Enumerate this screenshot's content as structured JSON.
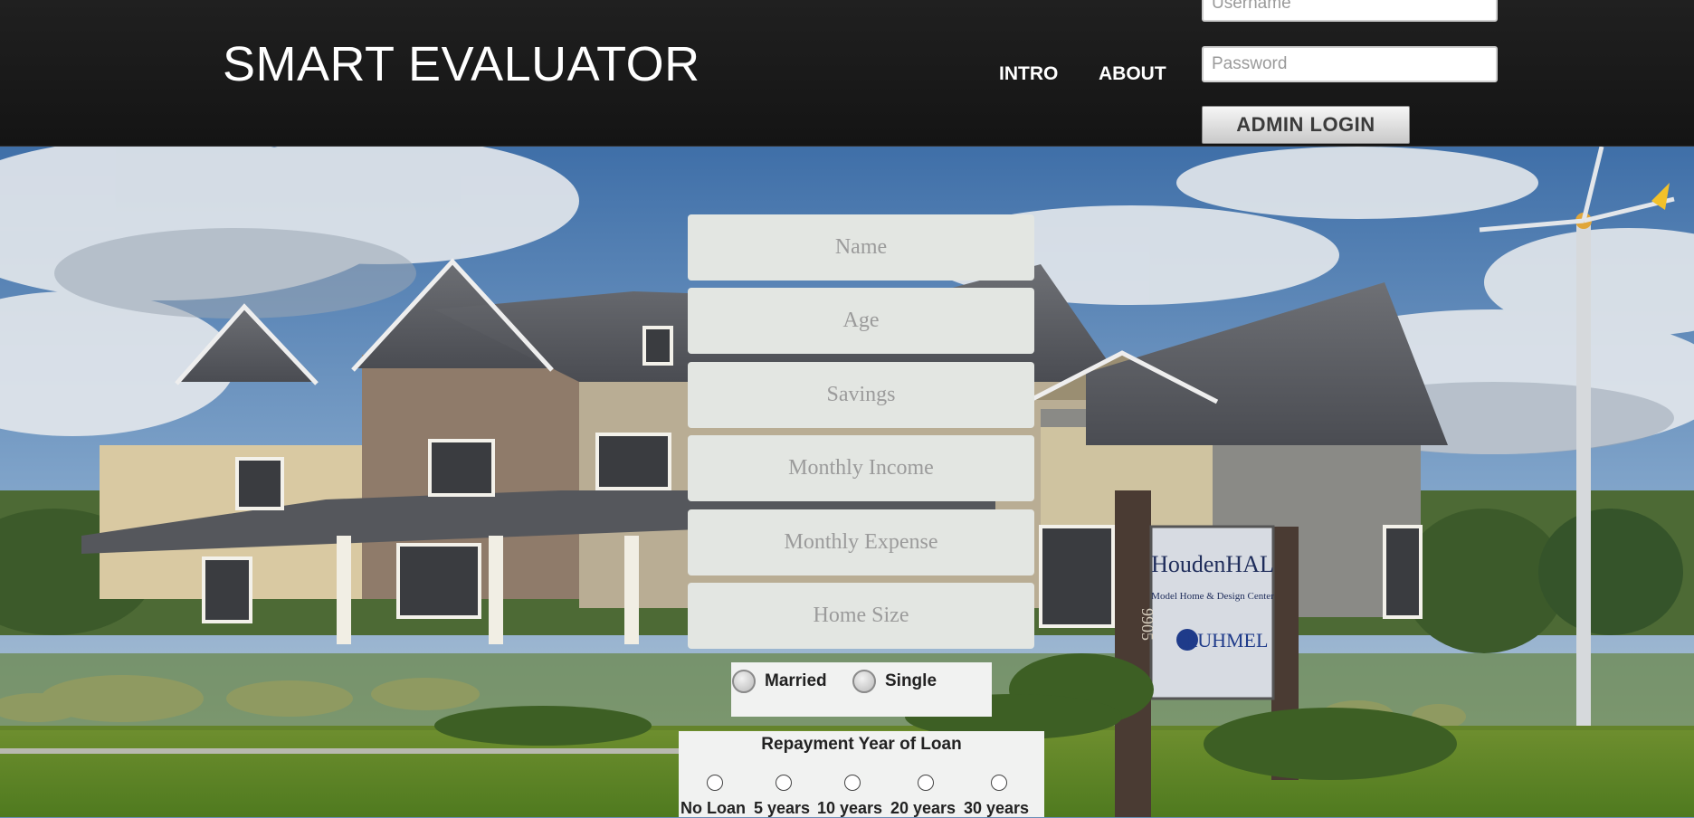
{
  "app": {
    "title": "SMART EVALUATOR"
  },
  "nav": {
    "items": [
      {
        "label": "INTRO"
      },
      {
        "label": "ABOUT"
      }
    ]
  },
  "login": {
    "username_placeholder": "Username",
    "password_placeholder": "Password",
    "button_label": "ADMIN LOGIN"
  },
  "form": {
    "fields": [
      {
        "placeholder": "Name"
      },
      {
        "placeholder": "Age"
      },
      {
        "placeholder": "Savings"
      },
      {
        "placeholder": "Monthly Income"
      },
      {
        "placeholder": "Monthly Expense"
      },
      {
        "placeholder": "Home Size"
      }
    ],
    "marital_status": {
      "options": [
        "Married",
        "Single"
      ]
    },
    "repayment": {
      "title": "Repayment Year of Loan",
      "options": [
        "No Loan",
        "5 years",
        "10 years",
        "20 years",
        "30 years"
      ]
    }
  },
  "hero": {
    "sign_line1": "HoudenHAL",
    "sign_line2": "Model Home & Design Center",
    "sign_line3": "RUHMEL",
    "post_number": "9905"
  }
}
